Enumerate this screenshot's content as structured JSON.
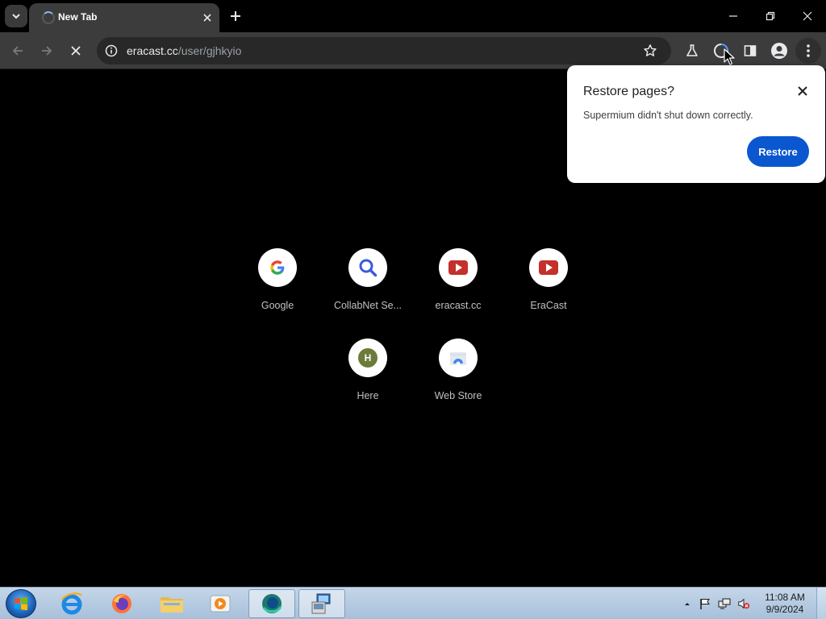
{
  "browser": {
    "tab": {
      "title": "New Tab"
    },
    "url": {
      "host": "eracast.cc",
      "path": "/user/gjhkyio"
    }
  },
  "restore_bubble": {
    "title": "Restore pages?",
    "message": "Supermium didn't shut down correctly.",
    "button_label": "Restore"
  },
  "shortcuts": [
    {
      "label": "Google",
      "icon": "google-icon"
    },
    {
      "label": "CollabNet Se...",
      "icon": "search-icon"
    },
    {
      "label": "eracast.cc",
      "icon": "youtube-icon"
    },
    {
      "label": "EraCast",
      "icon": "youtube-icon"
    },
    {
      "label": "Here",
      "icon": "letter-badge-icon",
      "badge": "H"
    },
    {
      "label": "Web Store",
      "icon": "web-store-icon"
    }
  ],
  "taskbar": {
    "clock": {
      "time": "11:08 AM",
      "date": "9/9/2024"
    },
    "apps": [
      "internet-explorer-icon",
      "firefox-icon",
      "file-explorer-icon",
      "media-player-icon",
      "supermium-icon",
      "remote-desktop-icon"
    ]
  },
  "colors": {
    "accent": "#0b57d0",
    "toolbar": "#3c3c3c",
    "page": "#000000"
  }
}
